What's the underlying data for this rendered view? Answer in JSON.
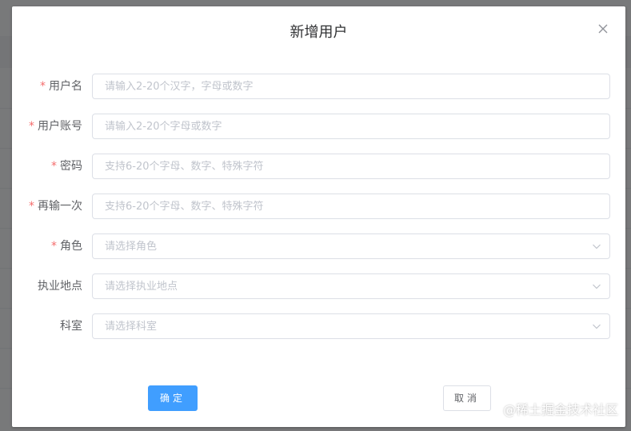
{
  "dialog": {
    "title": "新增用户"
  },
  "form": {
    "required_mark": "*",
    "fields": [
      {
        "label": "用户名",
        "placeholder": "请输入2-20个汉字，字母或数字",
        "value": ""
      },
      {
        "label": "用户账号",
        "placeholder": "请输入2-20个字母或数字",
        "value": ""
      },
      {
        "label": "密码",
        "placeholder": "支持6-20个字母、数字、特殊字符",
        "value": ""
      },
      {
        "label": "再输一次",
        "placeholder": "支持6-20个字母、数字、特殊字符",
        "value": ""
      },
      {
        "label": "角色",
        "placeholder": "请选择角色",
        "value": ""
      },
      {
        "label": "执业地点",
        "placeholder": "请选择执业地点",
        "value": ""
      },
      {
        "label": "科室",
        "placeholder": "请选择科室",
        "value": ""
      }
    ]
  },
  "footer": {
    "confirm_label": "确定",
    "cancel_label": "取消"
  },
  "watermark": "@稀土掘金技术社区",
  "colors": {
    "primary": "#409eff",
    "required": "#f56c6c",
    "border": "#dcdfe6",
    "placeholder": "#c0c4cc",
    "mask": "rgba(0,0,0,0.5)"
  },
  "icons": {
    "close": "close-icon",
    "select_arrow": "chevron-down-icon"
  }
}
